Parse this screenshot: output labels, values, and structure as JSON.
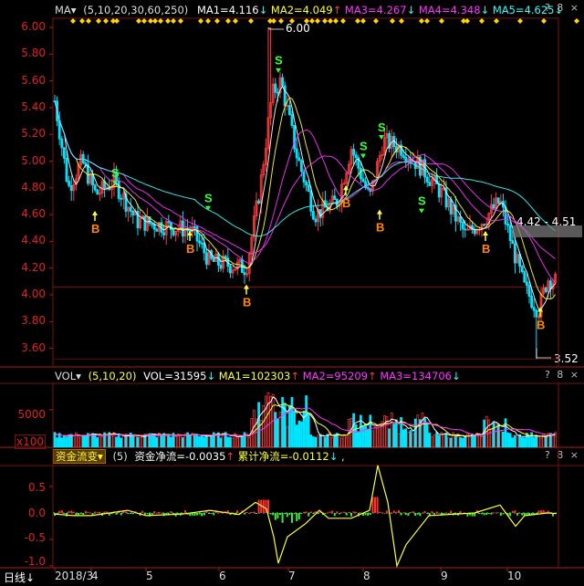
{
  "main_header": {
    "name": "MA",
    "params": "(5,10,20,30,60,250)",
    "ma1": "MA1=4.116",
    "ma2": "MA2=4.049",
    "ma3": "MA3=4.267",
    "ma4": "MA4=4.348",
    "ma5": "MA5=4.625",
    "corner": "? 8 ×"
  },
  "vol_header": {
    "name": "VOL",
    "params": "(5,10,20)",
    "vol": "VOL=31595",
    "ma1": "MA1=102303",
    "ma2": "MA2=95209",
    "ma3": "MA3=134706",
    "corner": "? 8 ×"
  },
  "flow_header": {
    "name": "资金流变",
    "params": "(5)",
    "net": "资金净流=-0.0035",
    "cum": "累计净流=-0.0112",
    "tail": ",",
    "corner": "? 8 ×"
  },
  "price_axis": [
    "6.00",
    "5.80",
    "5.60",
    "5.40",
    "5.20",
    "5.00",
    "4.80",
    "4.60",
    "4.40",
    "4.20",
    "4.00",
    "3.80",
    "3.60"
  ],
  "vol_axis": [
    "5000",
    "x100"
  ],
  "flow_axis": [
    "0.5",
    "0.0",
    "-0.5",
    "-1.0"
  ],
  "annotations": {
    "high": "6.00",
    "low": "3.52",
    "range": "4.42 - 4.51"
  },
  "x_axis": {
    "period": "日线",
    "labels": [
      "2018/3",
      "4",
      "5",
      "6",
      "7",
      "8",
      "9",
      "10"
    ]
  },
  "colors": {
    "up": "#ff3b3b",
    "down": "#00e5ff",
    "ma1": "#ffffff",
    "ma2": "#ffff33",
    "ma3": "#ff33ff",
    "ma4": "#33ff33",
    "ma5": "#33ffff",
    "buy": "#ff8800",
    "sell": "#33ff33"
  },
  "chart_data": {
    "type": "candlestick",
    "x_labels": [
      "2018/3",
      "4",
      "5",
      "6",
      "7",
      "8",
      "9",
      "10"
    ],
    "ylim": [
      3.5,
      6.05
    ],
    "y_ticks": [
      6.0,
      5.8,
      5.6,
      5.4,
      5.2,
      5.0,
      4.8,
      4.6,
      4.4,
      4.2,
      4.0,
      3.8,
      3.6
    ],
    "highest": 6.0,
    "lowest": 3.52,
    "last_close_ma1": 4.116,
    "highlight_range": [
      4.42,
      4.51
    ],
    "signals": {
      "buy_label": "B",
      "sell_label": "S",
      "buy_prices": [
        4.58,
        4.43,
        4.03,
        4.77,
        4.59,
        4.43,
        3.86
      ],
      "sell_prices": [
        4.8,
        4.61,
        5.64,
        5.0,
        5.14,
        4.59
      ]
    },
    "volume": {
      "ylim": [
        0,
        8000
      ],
      "ticks": [
        5000
      ],
      "unit": "x100"
    },
    "fund_flow": {
      "ylim": [
        -1.1,
        0.95
      ],
      "ticks": [
        0.5,
        0.0,
        -0.5,
        -1.0
      ]
    }
  }
}
